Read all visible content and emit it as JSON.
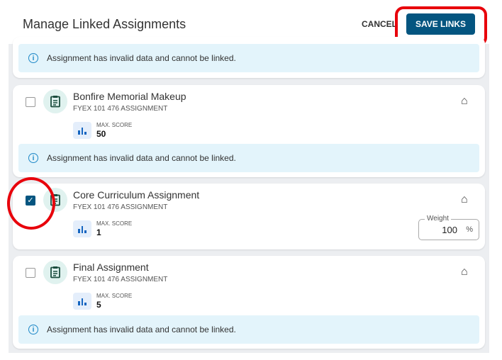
{
  "header": {
    "title": "Manage Linked Assignments",
    "cancel_label": "CANCEL",
    "save_label": "SAVE LINKS"
  },
  "invalid_message": "Assignment has invalid data and cannot be linked.",
  "assignments": [
    {
      "name": "Bonfire Memorial Makeup",
      "subtitle": "FYEX 101 476 ASSIGNMENT",
      "score_label": "MAX. SCORE",
      "score": "50",
      "checked": false
    },
    {
      "name": "Core Curriculum Assignment",
      "subtitle": "FYEX 101 476 ASSIGNMENT",
      "score_label": "MAX. SCORE",
      "score": "1",
      "checked": true,
      "weight_label": "Weight",
      "weight": "100",
      "weight_unit": "%"
    },
    {
      "name": "Final Assignment",
      "subtitle": "FYEX 101 476 ASSIGNMENT",
      "score_label": "MAX. SCORE",
      "score": "5",
      "checked": false
    }
  ],
  "colors": {
    "primary": "#045580",
    "alert_bg": "#e3f4fb",
    "annotation": "#e8000b"
  }
}
